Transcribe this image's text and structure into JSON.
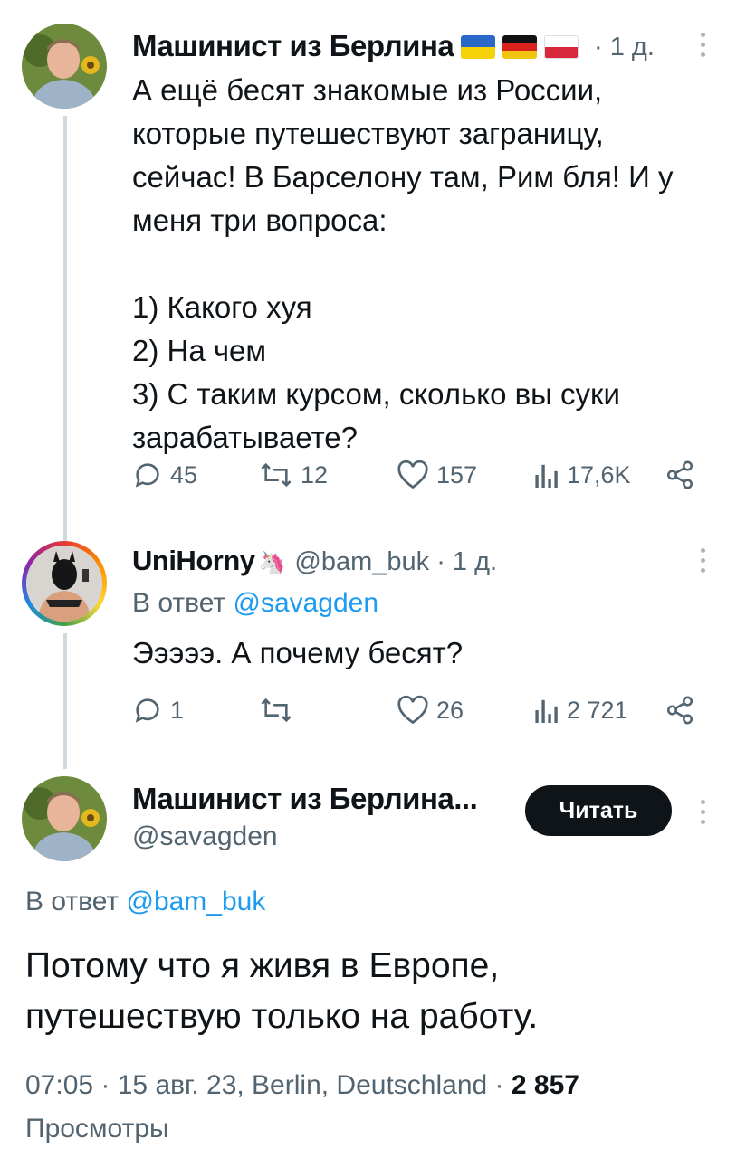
{
  "tweets": [
    {
      "author_name": "Машинист из Берлина",
      "flags": [
        "ukraine-flag",
        "germany-flag",
        "poland-flag"
      ],
      "time": "· 1 д.",
      "text": "А ещё бесят знакомые из России,\nкоторые путешествуют заграницу,\nсейчас! В Барселону там, Рим бля! И у\nменя три вопроса:\n\n1) Какого хуя\n2) На чем\n3) С таким курсом, сколько вы суки\nзарабатываете?",
      "replies": "45",
      "retweets": "12",
      "likes": "157",
      "views": "17,6K"
    },
    {
      "author_name": "UniHorny",
      "badge": "unicorn-emoji",
      "handle": "@bam_buk",
      "time": "· 1 д.",
      "reply_prefix": "В ответ",
      "reply_to": "@savagden",
      "text": "Эээээ. А почему бесят?",
      "replies": "1",
      "retweets": "",
      "likes": "26",
      "views": "2 721"
    }
  ],
  "main_tweet": {
    "author_name": "Машинист из Берлина...",
    "handle": "@savagden",
    "follow_label": "Читать",
    "reply_prefix": "В ответ",
    "reply_to": "@bam_buk",
    "text": "Потому что я живя в Европе,\nпутешествую только на работу.",
    "meta": "07:05 · 15 авг. 23, Berlin, Deutschland ·",
    "views_count": "2 857",
    "views_label": "Просмотры"
  },
  "colors": {
    "text": "#0f1419",
    "muted": "#536471",
    "link": "#1d9bf0",
    "thread_line": "#cfd9de",
    "button_bg": "#0f1419"
  }
}
